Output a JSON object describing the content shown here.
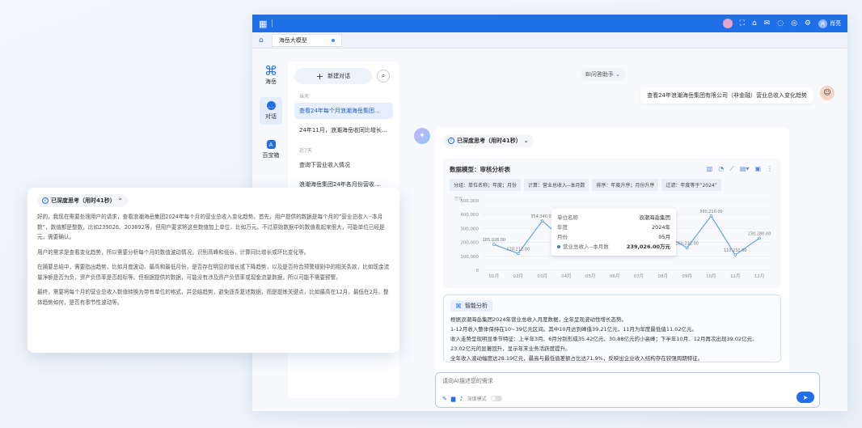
{
  "topbar": {
    "user": "肖亮"
  },
  "tab": {
    "label": "海岳大模型"
  },
  "nav": {
    "brand": "海岳",
    "chat": "对话",
    "store": "百宝箱"
  },
  "conv": {
    "new_label": "新建对话",
    "group_today": "当天",
    "group_week": "近7天",
    "items": [
      "查看24年每个月浪潮海岳集团...",
      "24年11月，浪潮海岳收同比增长...",
      "查询下营业收入情况",
      "浪潮海岳集团24年各月份营收..."
    ]
  },
  "main": {
    "assistant": "BI问答助手",
    "question": "查看24年浪潮海岳集团有限公司（非金融）营业总收入变化趋势",
    "think_label": "已深度思考（用时41秒）"
  },
  "chart_card": {
    "title": "数据模型：审核分析表",
    "filters": [
      "分组：单位名称；年度；月份",
      "计算：营业总收入--本月数",
      "排序：年度升序；月份升序",
      "过滤：年度等于“2024”"
    ]
  },
  "tooltip": {
    "k1": "单位名称",
    "v1": "浪潮海岳集团",
    "k2": "年度",
    "v2": "2024年",
    "k3": "月份",
    "v3": "05月",
    "k4": "营业总收入--本月数",
    "v4": "239,026.00万元"
  },
  "chart_data": {
    "type": "line",
    "unit": "万元",
    "categories": [
      "01月",
      "02月",
      "03月",
      "04月",
      "05月",
      "06月",
      "07月",
      "08月",
      "09月",
      "10月",
      "11月",
      "12月"
    ],
    "values": [
      185026,
      120212,
      354340,
      203892,
      239026,
      300000,
      308800,
      265000,
      160232,
      390210,
      110232,
      230280
    ],
    "labels": [
      "185,026.00",
      "120,212.00",
      "354,340.00",
      "203,892.00",
      "",
      "",
      "",
      "",
      "160,232.00",
      "390,210.00",
      "110,232.00",
      "230,280.00"
    ],
    "ylim": [
      0,
      500000
    ],
    "yticks": [
      "0",
      "100,000",
      "200,000",
      "300,000",
      "400,000",
      "500,000"
    ],
    "color": "#5a9cf0"
  },
  "analysis": {
    "title": "智能分析",
    "lines": [
      "根据浪潮海岳集团2024年营业总收入月度数据，全年呈现波动性增长态势。",
      "1-12月收入整体保持在10~39亿元区间。其中10月达到峰值39.21亿元，11月为年度最低值11.02亿元。",
      "收入走势呈现明显季节特征：上半年3月、6月分别形成35.42亿元、30.88亿元的小高峰；下半年10月、12月再次出现39.02亿元、",
      "23.02亿元的显著回升，显示年末业务活跃度提升。",
      "全年收入波动幅度达28.19亿元，最高与最低值差额占比达71.9%，反映出企业收入结构存在较强周期特征。"
    ]
  },
  "input": {
    "placeholder": "请向AI描述您的需求",
    "mode": "深度模式"
  },
  "think_card": {
    "label": "已深度思考（用时41秒）",
    "paras": [
      "好的，我现在需要处理用户的请求，查看浪潮海岳集团2024年每个月的营业总收入变化趋势。首先，用户提供的数据是每个月的“营业总收入--本月数”，数值都是整数，比如239026、203892等。但用户要求将这些数值加上单位，比如万元。不过原始数据中的数值看起来很大，可能单位已经是元，需要确认。",
      "用户的需求是查看变化趋势，所以需要分析每个月的数值波动情况，识别高峰和低谷，计算同比增长或环比变化等。",
      "在摘要总结中，需要指出趋势，比如月度波动、最高和最低月份，是否存在明显的增长或下降趋势，以及是否符合预警规则中的相关条款，比如现金流量净额是否为负，资产负债率是否超标等。但根据提供的数据，可能没有涉及资产负债率或现金流量数据，所以可能不需要预警。",
      "最终，需要将每个月的营业总收入数值转换为带有单位的格式，并总结趋势，避免逐条复述数据，而是提炼关键点，比如最高在12月，最低在2月，整体趋势如何，是否有季节性波动等。"
    ]
  }
}
